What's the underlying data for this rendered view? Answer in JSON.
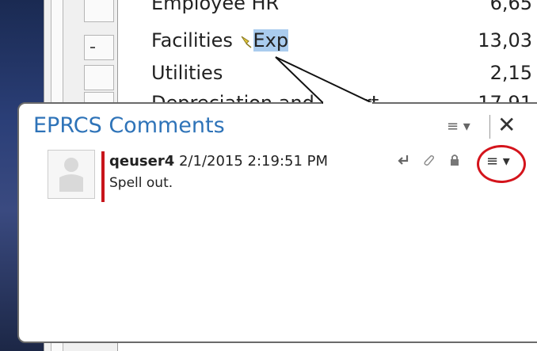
{
  "sheet": {
    "rows": [
      {
        "label": "Employee HR",
        "value": "6,65"
      },
      {
        "label": "Facilities",
        "highlight": "Exp",
        "value": "13,03"
      },
      {
        "label": "Utilities",
        "value": "2,15"
      },
      {
        "label": "Depreciation and Amort",
        "value": "17,91"
      }
    ]
  },
  "panel": {
    "title": "EPRCS Comments",
    "menu_glyph": "≡ ▾",
    "close_glyph": "✕",
    "comment": {
      "user": "qeuser4",
      "timestamp": "2/1/2015 2:19:51 PM",
      "text": "Spell out.",
      "actions": {
        "reply_icon": "reply-icon",
        "attach_icon": "paperclip-icon",
        "lock_icon": "lock-icon",
        "menu_glyph": "≡ ▾"
      }
    }
  }
}
